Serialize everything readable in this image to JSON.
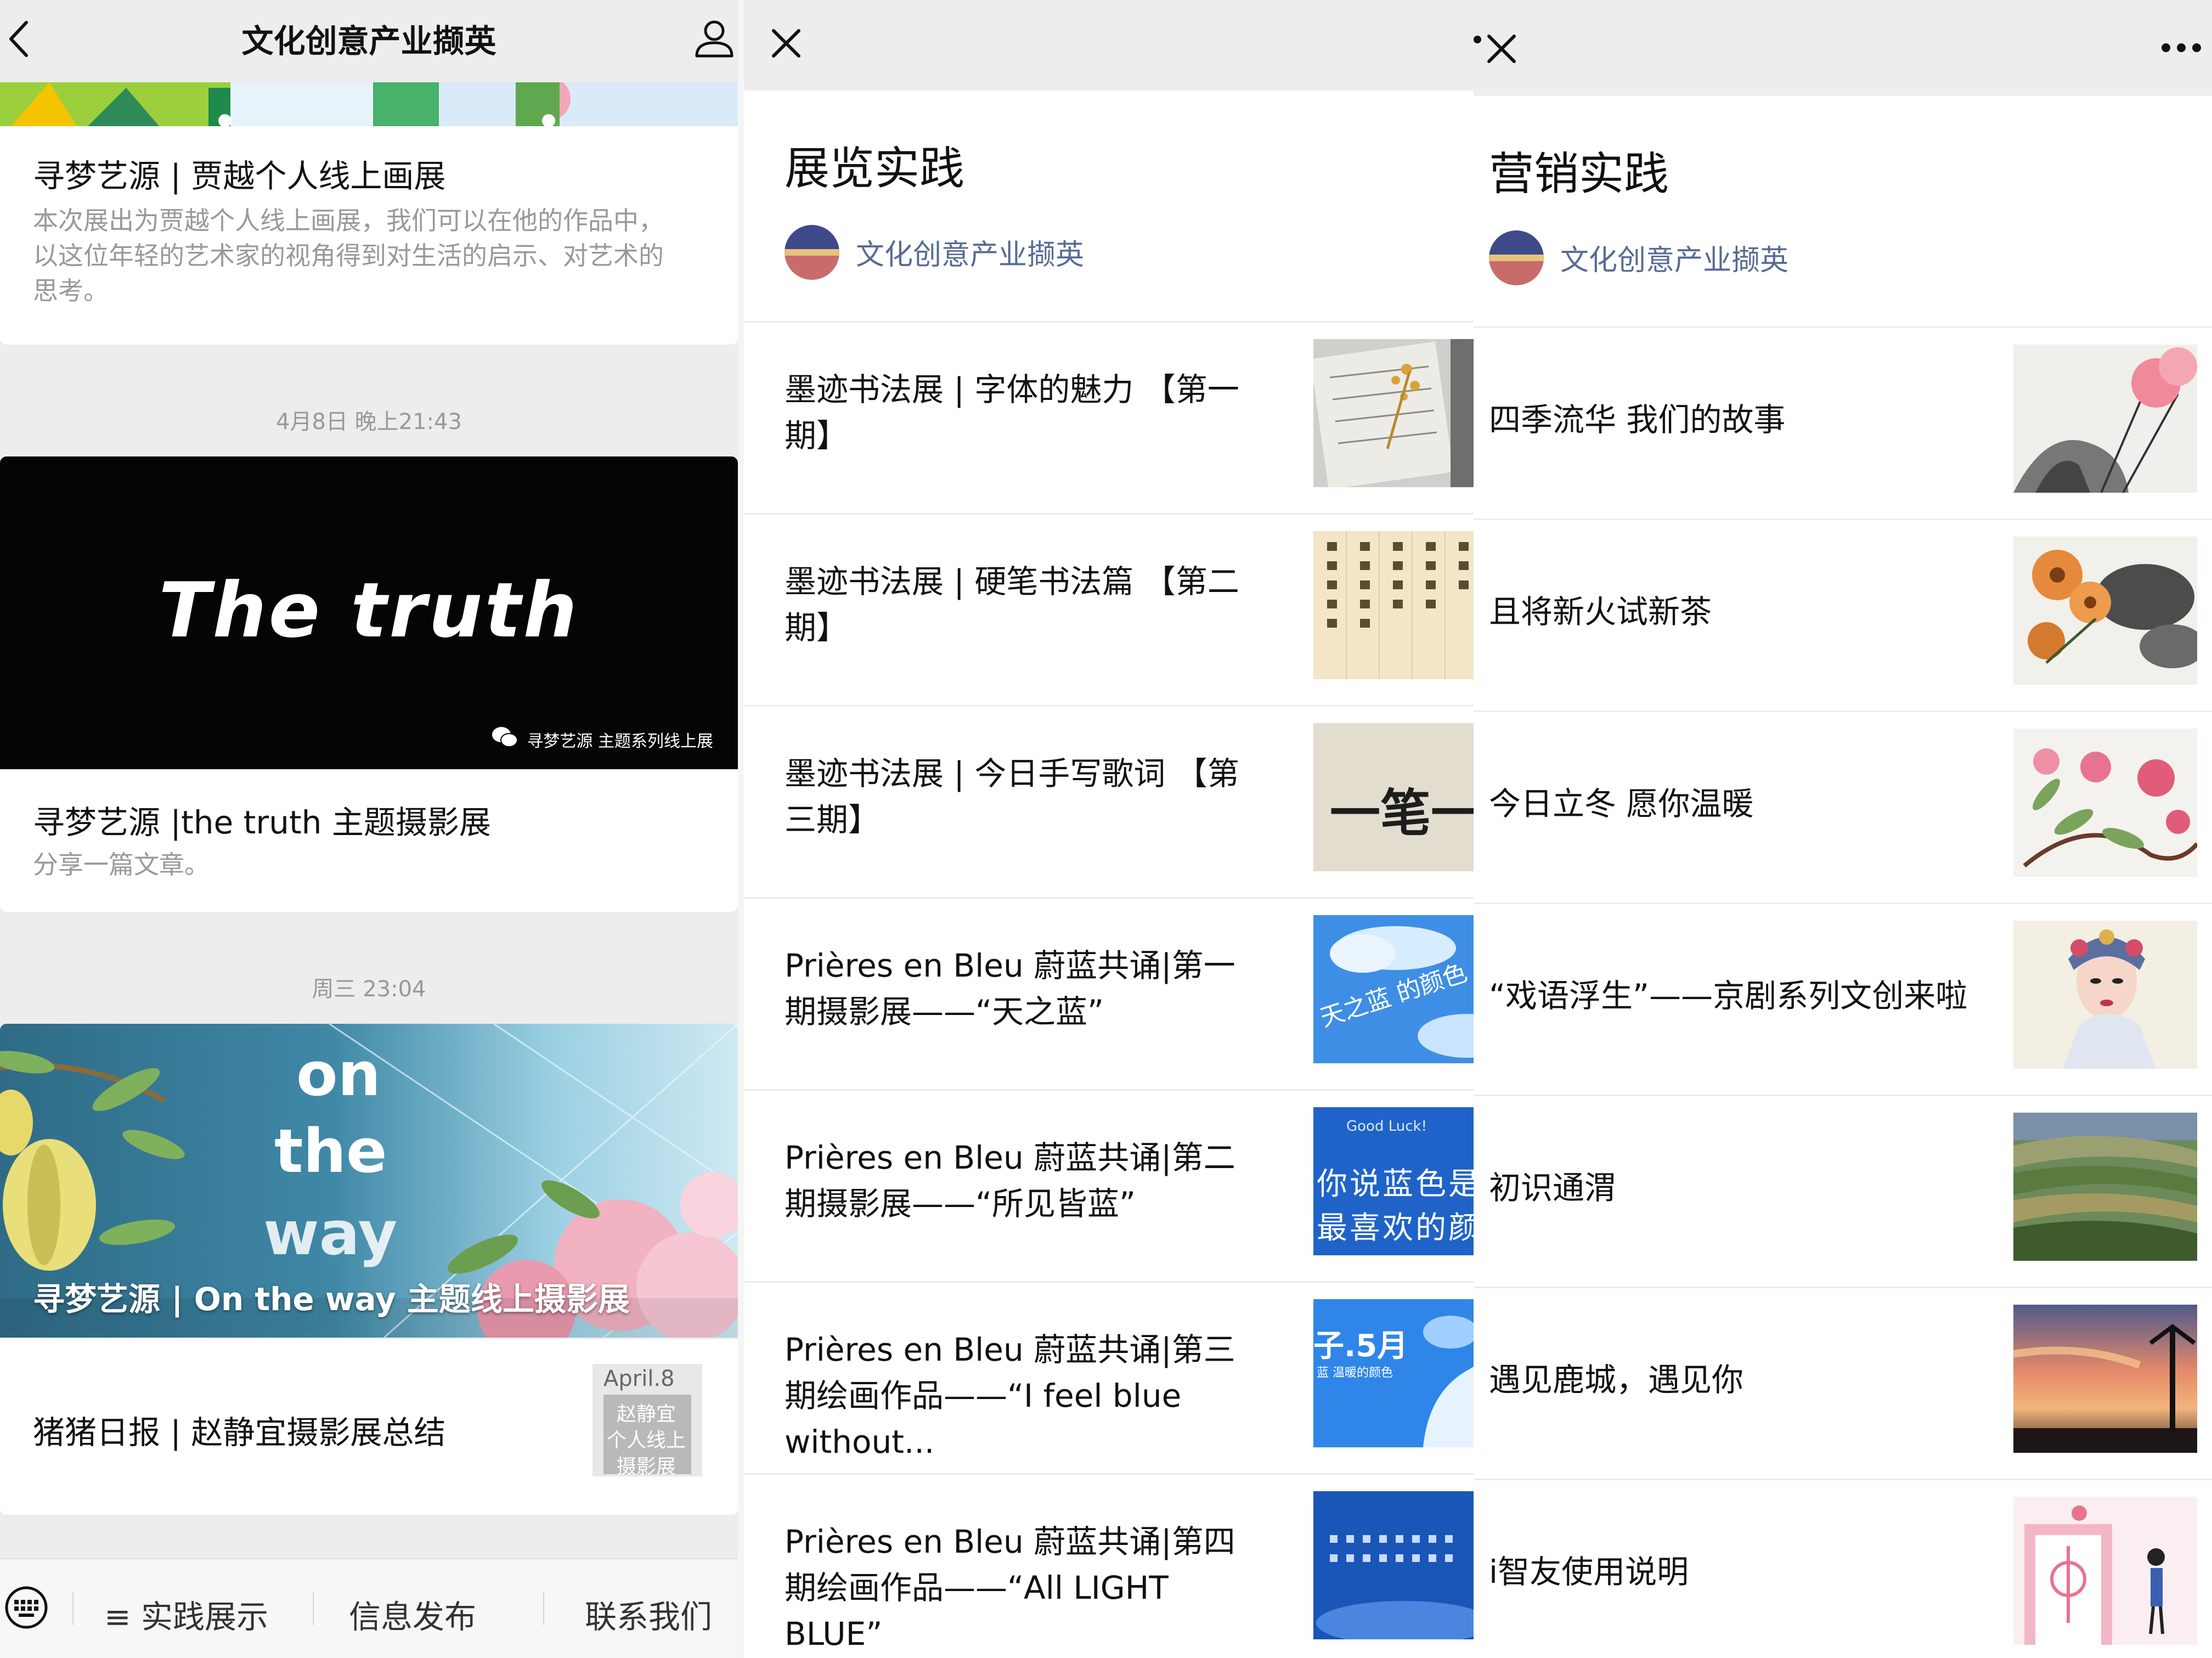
{
  "panel1": {
    "title": "文化创意产业撷英",
    "cards": [
      {
        "title": "寻梦艺源 | 贾越个人线上画展",
        "desc": "本次展出为贾越个人线上画展，我们可以在他的作品中，以这位年轻的艺术家的视角得到对生活的启示、对艺术的思考。"
      },
      {
        "timestamp": "4月8日 晚上21:43",
        "hero_text": "The truth",
        "hero_caption": "寻梦艺源 主题系列线上展",
        "title": "寻梦艺源 |the truth 主题摄影展",
        "desc": "分享一篇文章。"
      },
      {
        "timestamp": "周三 23:04",
        "hero_overlay": "寻梦艺源 | On the way 主题线上摄影展",
        "hero_art_words": [
          "on",
          "the",
          "way"
        ],
        "sub_title": "猪猪日报 | 赵静宜摄影展总结",
        "sub_thumb_text": [
          "April.8",
          "赵静宜",
          "个人线上",
          "摄影展"
        ]
      }
    ],
    "tabs": [
      "≡ 实践展示",
      "信息发布",
      "联系我们"
    ]
  },
  "panel2": {
    "title": "展览实践",
    "account": "文化创意产业撷英",
    "articles": [
      {
        "title": "墨迹书法展 | 字体的魅力 【第一期】"
      },
      {
        "title": "墨迹书法展 | 硬笔书法篇 【第二期】"
      },
      {
        "title": "墨迹书法展 | 今日手写歌词 【第三期】",
        "thumb_text": "一笔一点"
      },
      {
        "title": "Prières en Bleu 蔚蓝共诵|第一期摄影展——“天之蓝”",
        "thumb_text": "天之蓝 的颜色"
      },
      {
        "title": "Prières en Bleu 蔚蓝共诵|第二期摄影展——“所见皆蓝”",
        "thumb_text": [
          "Good Luck!",
          "你说蓝色是",
          "最喜欢的颜"
        ]
      },
      {
        "title": "Prières en Bleu 蔚蓝共诵|第三期绘画作品——“I feel blue without...",
        "thumb_text": [
          "子.5月",
          "蓝 温暖的颜色"
        ]
      },
      {
        "title": "Prières en Bleu 蔚蓝共诵|第四期绘画作品——“All LIGHT BLUE”"
      }
    ]
  },
  "panel3": {
    "title": "营销实践",
    "account": "文化创意产业撷英",
    "articles": [
      {
        "title": "四季流华 我们的故事"
      },
      {
        "title": "且将新火试新茶"
      },
      {
        "title": "今日立冬 愿你温暖"
      },
      {
        "title": "“戏语浮生”——京剧系列文创来啦"
      },
      {
        "title": "初识通渭"
      },
      {
        "title": "遇见鹿城，遇见你"
      },
      {
        "title": "i智友使用说明"
      }
    ]
  },
  "colors": {
    "link_blue": "#576b95",
    "nav_bg": "#ededed",
    "muted_text": "#999999"
  }
}
